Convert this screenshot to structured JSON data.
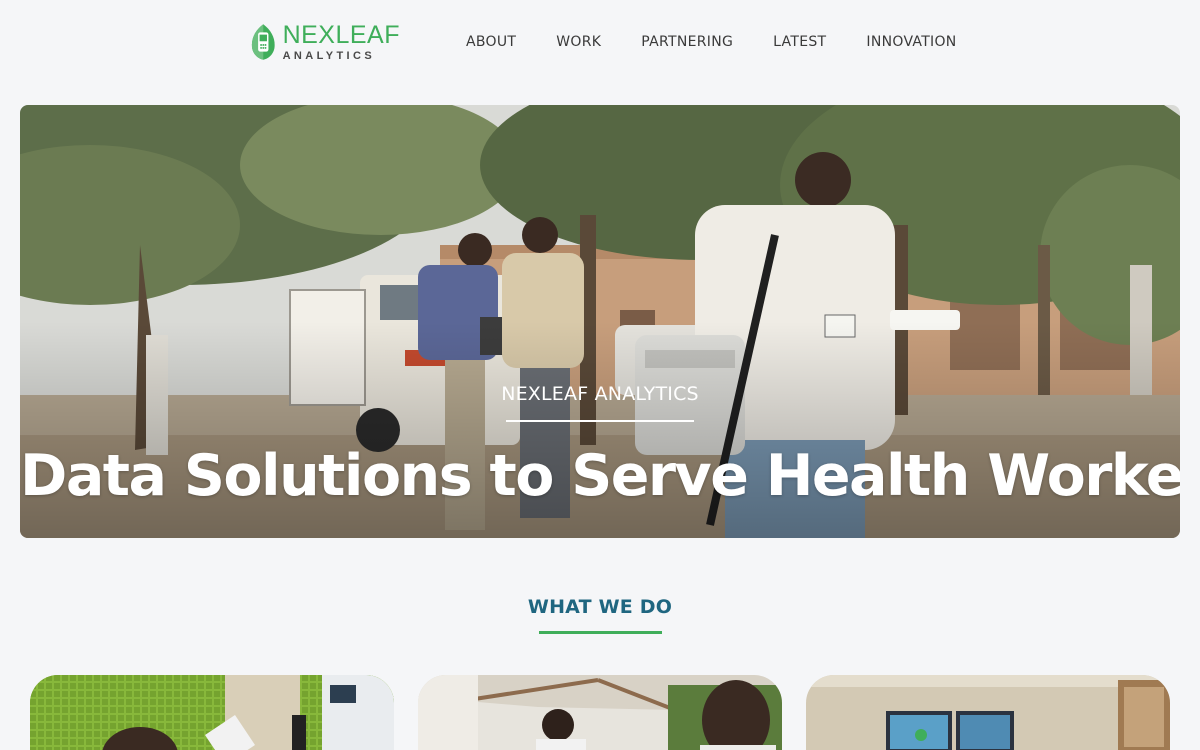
{
  "brand": {
    "name": "NEXLEAF",
    "tagline": "ANALYTICS",
    "color_green": "#3fae5a",
    "color_grey": "#4a4a4a"
  },
  "nav": {
    "items": [
      "ABOUT",
      "WORK",
      "PARTNERING",
      "LATEST",
      "INNOVATION"
    ]
  },
  "hero": {
    "eyebrow": "NEXLEAF ANALYTICS",
    "title": "Data Solutions to Serve Health Workers"
  },
  "section": {
    "title": "WHAT WE DO",
    "title_color": "#1f6680",
    "accent_color": "#3fae5a"
  },
  "cards": [
    {
      "image": "health-worker-at-green-wall-photo"
    },
    {
      "image": "health-workers-under-tent-photo"
    },
    {
      "image": "office-with-monitors-photo"
    }
  ]
}
